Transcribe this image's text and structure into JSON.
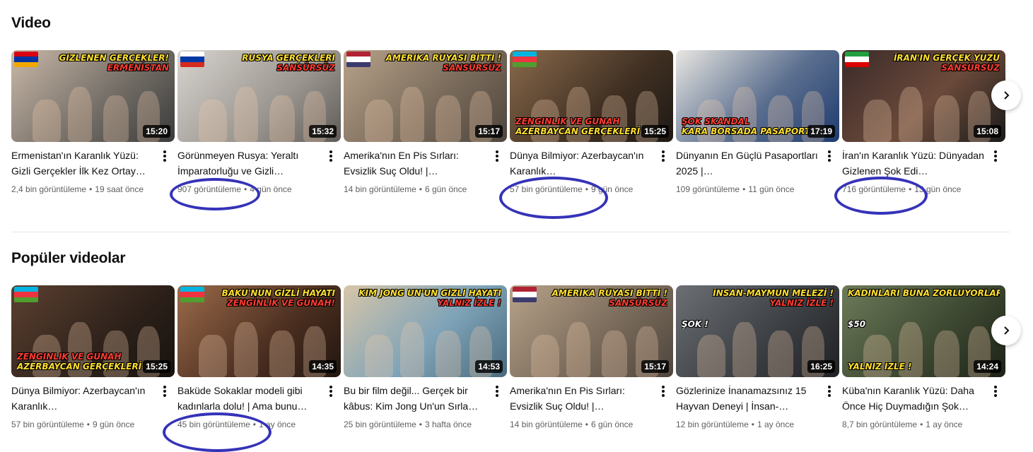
{
  "sections": [
    {
      "title": "Video",
      "videos": [
        {
          "title": "Ermenistan'ın Karanlık Yüzü: Gizli Gerçekler İlk Kez Ortay…",
          "views": "2,4 bin görüntüleme",
          "age": "19 saat önce",
          "duration": "15:20",
          "thumb_top": "GİZLENEN GERÇEKLER!",
          "thumb_top2": "ERMENİSTAN",
          "thumb_bottom": ""
        },
        {
          "title": "Görünmeyen Rusya: Yeraltı İmparatorluğu ve Gizli…",
          "views": "907 görüntüleme",
          "age": "4 gün önce",
          "duration": "15:32",
          "thumb_top": "RUSYA GERÇEKLERİ",
          "thumb_top2": "SANSÜRSÜZ",
          "thumb_bottom": ""
        },
        {
          "title": "Amerika'nın En Pis Sırları: Evsizlik Suç Oldu! |…",
          "views": "14 bin görüntüleme",
          "age": "6 gün önce",
          "duration": "15:17",
          "thumb_top": "AMERİKA RÜYASI BİTTİ !",
          "thumb_top2": "SANSÜRSÜZ",
          "thumb_bottom": ""
        },
        {
          "title": "Dünya Bilmiyor: Azerbaycan'ın Karanlık…",
          "views": "57 bin görüntüleme",
          "age": "9 gün önce",
          "duration": "15:25",
          "thumb_top": "",
          "thumb_top2": "",
          "thumb_bottom": "ZENGİNLİK VE GÜNAH",
          "thumb_bottom2": "AZERBAYCAN GERÇEKLERİ"
        },
        {
          "title": "Dünyanın En Güçlü Pasaportları 2025 |…",
          "views": "109 görüntüleme",
          "age": "11 gün önce",
          "duration": "17:19",
          "thumb_top": "",
          "thumb_top2": "",
          "thumb_bottom": "ŞOK SKANDAL",
          "thumb_bottom2": "KARA BORSADA PASAPORT"
        },
        {
          "title": "İran'ın Karanlık Yüzü: Dünyadan Gizlenen Şok Edi…",
          "views": "716 görüntüleme",
          "age": "13 gün önce",
          "duration": "15:08",
          "thumb_top": "İRAN'IN GERÇEK YÜZÜ",
          "thumb_top2": "SANSÜRSÜZ",
          "thumb_bottom": ""
        }
      ]
    },
    {
      "title": "Popüler videolar",
      "videos": [
        {
          "title": "Dünya Bilmiyor: Azerbaycan'ın Karanlık…",
          "views": "57 bin görüntüleme",
          "age": "9 gün önce",
          "duration": "15:25",
          "thumb_top": "",
          "thumb_top2": "",
          "thumb_bottom": "ZENGİNLİK VE GÜNAH",
          "thumb_bottom2": "AZERBAYCAN GERÇEKLERİ"
        },
        {
          "title": "Baküde Sokaklar modeli gibi kadınlarla dolu! | Ama bunu…",
          "views": "45 bin görüntüleme",
          "age": "1 ay önce",
          "duration": "14:35",
          "thumb_top": "BAKÜ'NÜN GİZLİ HAYATI",
          "thumb_top2": "ZENGİNLİK VE GÜNAH!",
          "thumb_bottom": ""
        },
        {
          "title": "Bu bir film değil... Gerçek bir kâbus: Kim Jong Un'un Sırla…",
          "views": "25 bin görüntüleme",
          "age": "3 hafta önce",
          "duration": "14:53",
          "thumb_top": "KİM JONG UN'UN GİZLİ HAYATI",
          "thumb_top2": "YALNIZ İZLE !",
          "thumb_bottom": ""
        },
        {
          "title": "Amerika'nın En Pis Sırları: Evsizlik Suç Oldu! |…",
          "views": "14 bin görüntüleme",
          "age": "6 gün önce",
          "duration": "15:17",
          "thumb_top": "AMERİKA RÜYASI BİTTİ !",
          "thumb_top2": "SANSÜRSÜZ",
          "thumb_bottom": ""
        },
        {
          "title": "Gözlerinize İnanamazsınız 15 Hayvan Deneyi | İnsan-…",
          "views": "12 bin görüntüleme",
          "age": "1 ay önce",
          "duration": "16:25",
          "thumb_top": "İNSAN-MAYMUN MELEZİ !",
          "thumb_top2": "YALNIZ İZLE !",
          "thumb_bottom": "",
          "thumb_mid": "ŞOK !"
        },
        {
          "title": "Küba'nın Karanlık Yüzü: Daha Önce Hiç Duymadığın Şok…",
          "views": "8,7 bin görüntüleme",
          "age": "1 ay önce",
          "duration": "14:24",
          "thumb_top": "KADINLARI BUNA ZORLUYORLAR",
          "thumb_top2": "",
          "thumb_bottom": "YALNIZ İZLE !",
          "thumb_mid": "$50"
        }
      ]
    }
  ],
  "theme": {
    "annotation_color": "#3533b8",
    "caption_yellow": "#ffdf2e",
    "caption_red": "#ff3b30"
  },
  "icons": {
    "next": "chevron-right-icon",
    "menu": "more-vert-icon"
  }
}
